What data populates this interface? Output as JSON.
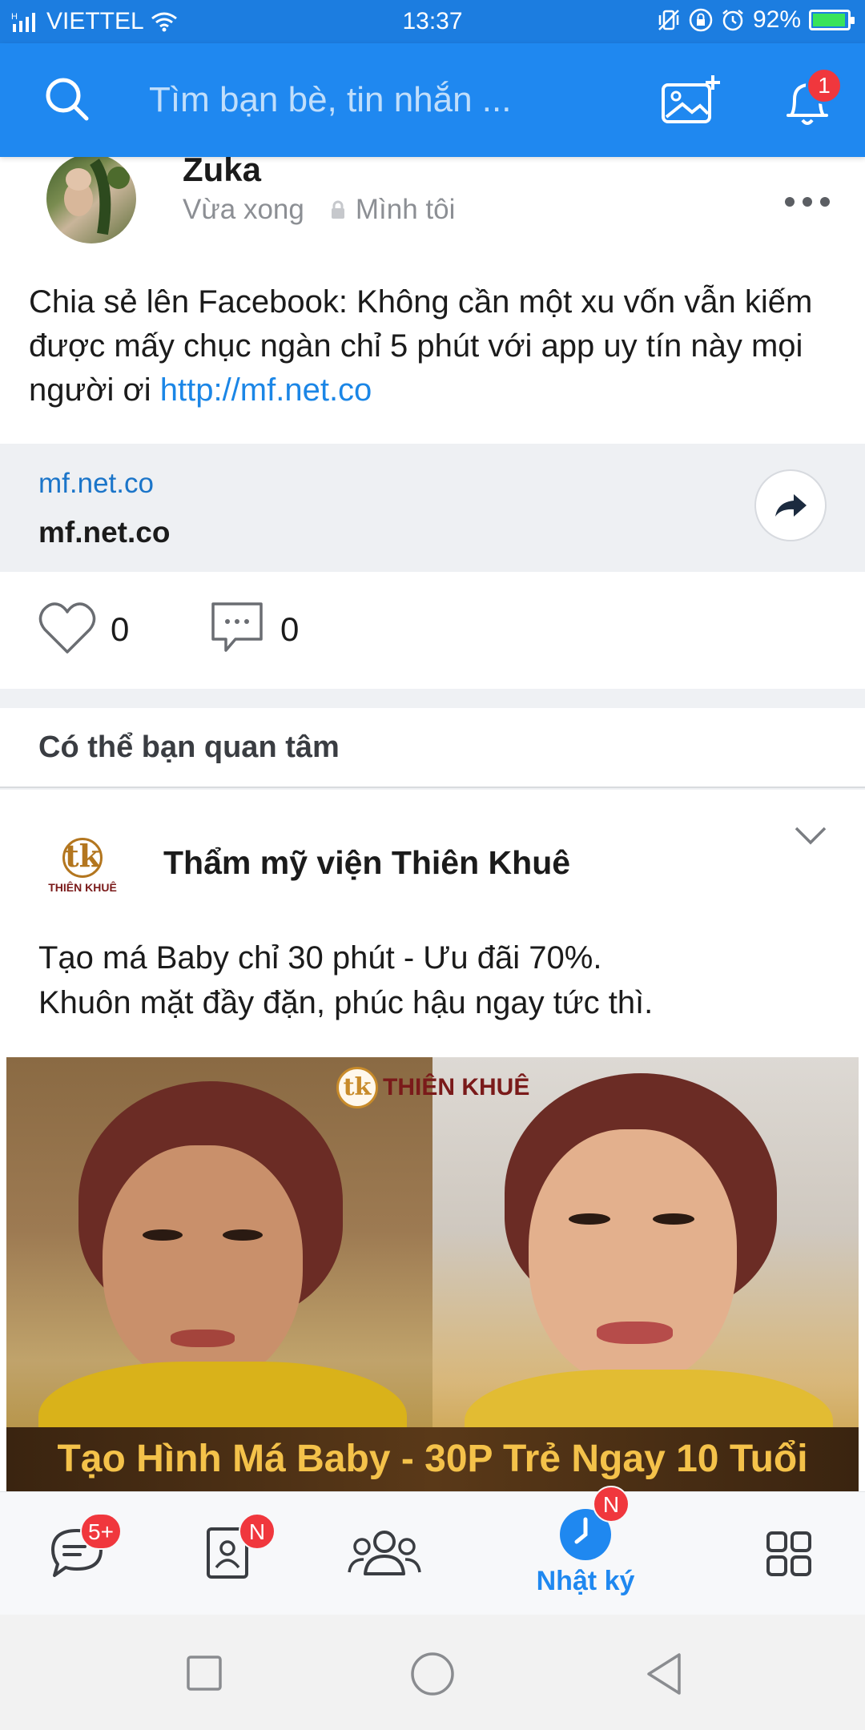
{
  "status_bar": {
    "carrier": "VIETTEL",
    "time": "13:37",
    "battery": "92%"
  },
  "header": {
    "search_placeholder": "Tìm bạn bè, tin nhắn ...",
    "notification_count": "1"
  },
  "post": {
    "author": "Zuka",
    "time": "Vừa xong",
    "privacy": "Mình tôi",
    "text": "Chia sẻ lên Facebook: Không cần một xu vốn vẫn kiếm được mấy chục ngàn chỉ 5 phút với app uy tín này mọi người ơi ",
    "link_text": "http://mf.net.co",
    "preview_domain": "mf.net.co",
    "preview_title": "mf.net.co",
    "likes": "0",
    "comments": "0"
  },
  "suggested": {
    "header": "Có thể bạn quan tâm",
    "ad_name": "Thẩm mỹ viện Thiên Khuê",
    "ad_text_line1": "Tạo má Baby chỉ 30 phút - Ưu đãi 70%.",
    "ad_text_line2": "Khuôn mặt đầy đặn, phúc hậu ngay tức thì.",
    "logo_monogram": "tk",
    "logo_brand": "THIÊN KHUÊ",
    "image_banner": "Tạo Hình Má Baby - 30P Trẻ Ngay 10 Tuổi"
  },
  "bottom_nav": {
    "messages_badge": "5+",
    "contacts_badge": "N",
    "timeline_badge": "N",
    "timeline_label": "Nhật ký"
  },
  "colors": {
    "brand_blue": "#1f88f0",
    "badge_red": "#f0373d",
    "link_blue": "#1b86e6"
  }
}
